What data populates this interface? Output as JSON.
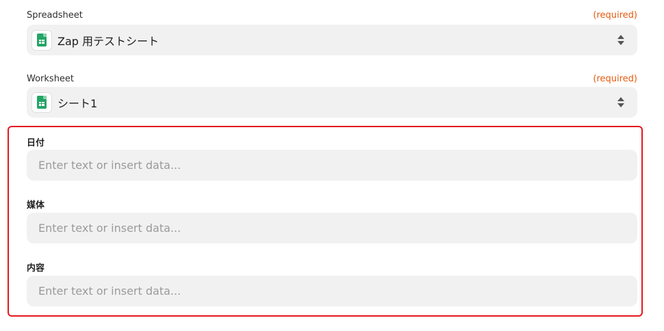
{
  "spreadsheet": {
    "label": "Spreadsheet",
    "required": "(required)",
    "value": "Zap 用テストシート",
    "icon": "google-sheets-icon"
  },
  "worksheet": {
    "label": "Worksheet",
    "required": "(required)",
    "value": "シート1",
    "icon": "google-sheets-icon"
  },
  "fields": [
    {
      "label": "日付",
      "placeholder": "Enter text or insert data..."
    },
    {
      "label": "媒体",
      "placeholder": "Enter text or insert data..."
    },
    {
      "label": "内容",
      "placeholder": "Enter text or insert data..."
    }
  ],
  "colors": {
    "required": "#e8590c",
    "highlight_border": "#e5161f",
    "field_background": "#f1f1f1",
    "sheets_green": "#23a566"
  }
}
